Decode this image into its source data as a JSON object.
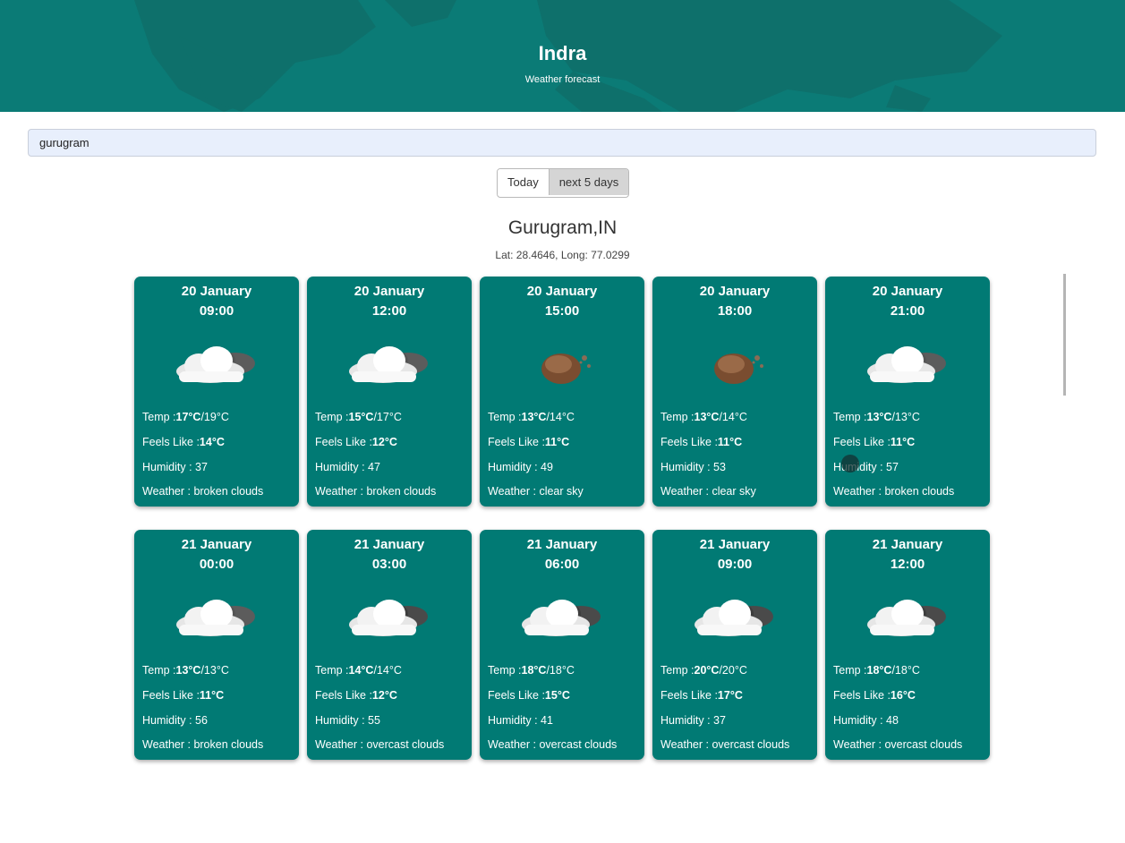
{
  "header": {
    "title": "Indra",
    "subtitle": "Weather forecast"
  },
  "search": {
    "value": "gurugram"
  },
  "tabs": {
    "today": "Today",
    "next5": "next 5 days"
  },
  "location": {
    "name": "Gurugram,IN",
    "coords": "Lat: 28.4646, Long: 77.0299"
  },
  "labels": {
    "temp": "Temp :",
    "feels": "Feels Like :",
    "humidity": "Humidity : ",
    "weather": "Weather : "
  },
  "colors": {
    "header": "#0b7b76",
    "card": "#017a74",
    "search_bg": "#e8effc"
  },
  "forecast": [
    {
      "date": "20 January",
      "time": "09:00",
      "icon": "broken-clouds-icon",
      "temp_max": "17°C",
      "temp_min": "/19°C",
      "feels": "14°C",
      "humidity": "37",
      "weather": "broken clouds"
    },
    {
      "date": "20 January",
      "time": "12:00",
      "icon": "broken-clouds-icon",
      "temp_max": "15°C",
      "temp_min": "/17°C",
      "feels": "12°C",
      "humidity": "47",
      "weather": "broken clouds"
    },
    {
      "date": "20 January",
      "time": "15:00",
      "icon": "clear-sky-icon",
      "temp_max": "13°C",
      "temp_min": "/14°C",
      "feels": "11°C",
      "humidity": "49",
      "weather": "clear sky"
    },
    {
      "date": "20 January",
      "time": "18:00",
      "icon": "clear-sky-icon",
      "temp_max": "13°C",
      "temp_min": "/14°C",
      "feels": "11°C",
      "humidity": "53",
      "weather": "clear sky"
    },
    {
      "date": "20 January",
      "time": "21:00",
      "icon": "broken-clouds-icon",
      "temp_max": "13°C",
      "temp_min": "/13°C",
      "feels": "11°C",
      "humidity": "57",
      "weather": "broken clouds"
    },
    {
      "date": "21 January",
      "time": "00:00",
      "icon": "broken-clouds-icon",
      "temp_max": "13°C",
      "temp_min": "/13°C",
      "feels": "11°C",
      "humidity": "56",
      "weather": "broken clouds"
    },
    {
      "date": "21 January",
      "time": "03:00",
      "icon": "overcast-clouds-icon",
      "temp_max": "14°C",
      "temp_min": "/14°C",
      "feels": "12°C",
      "humidity": "55",
      "weather": "overcast clouds"
    },
    {
      "date": "21 January",
      "time": "06:00",
      "icon": "overcast-clouds-icon",
      "temp_max": "18°C",
      "temp_min": "/18°C",
      "feels": "15°C",
      "humidity": "41",
      "weather": "overcast clouds"
    },
    {
      "date": "21 January",
      "time": "09:00",
      "icon": "overcast-clouds-icon",
      "temp_max": "20°C",
      "temp_min": "/20°C",
      "feels": "17°C",
      "humidity": "37",
      "weather": "overcast clouds"
    },
    {
      "date": "21 January",
      "time": "12:00",
      "icon": "overcast-clouds-icon",
      "temp_max": "18°C",
      "temp_min": "/18°C",
      "feels": "16°C",
      "humidity": "48",
      "weather": "overcast clouds"
    }
  ]
}
